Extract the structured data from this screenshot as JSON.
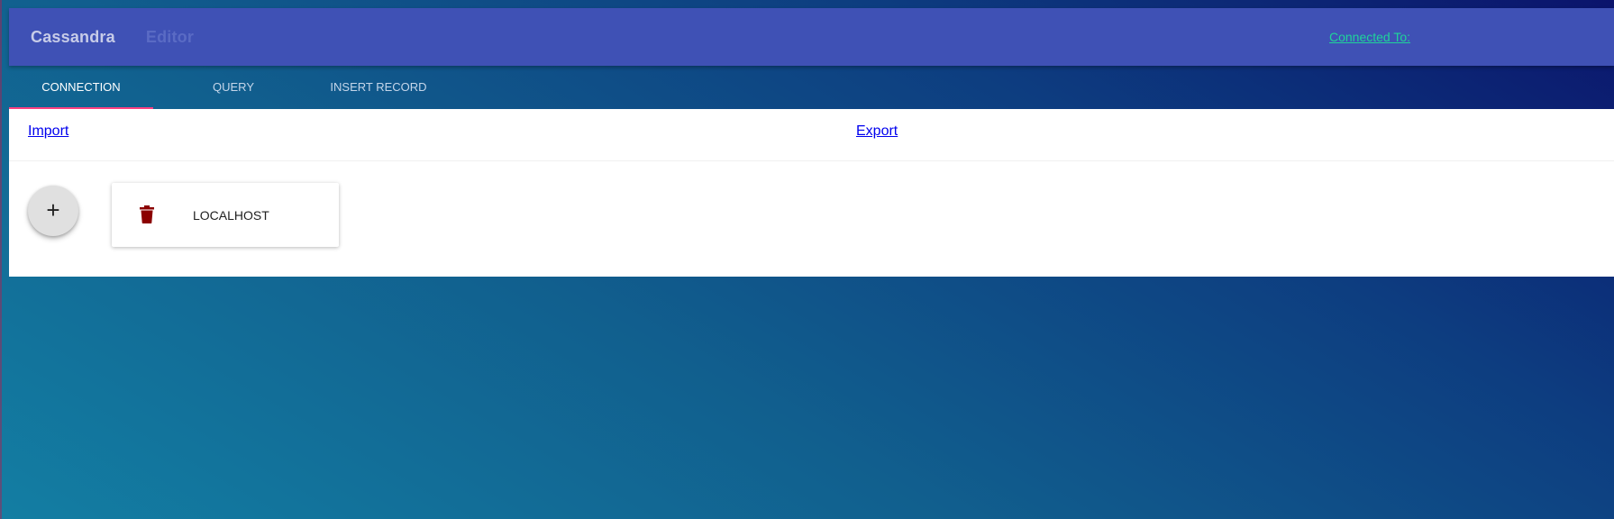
{
  "header": {
    "title_word1": "Cassandra",
    "title_word2": "Editor",
    "connected_label": "Connected To:",
    "background_color": "#3f51b5"
  },
  "tabs": [
    {
      "label": "CONNECTION",
      "active": true
    },
    {
      "label": "QUERY",
      "active": false
    },
    {
      "label": "INSERT RECORD",
      "active": false
    }
  ],
  "panel": {
    "import_label": "Import",
    "export_label": "Export",
    "add_button_glyph": "+",
    "connections": [
      {
        "name": "LOCALHOST",
        "icon": "trash-icon",
        "icon_color": "#8b0000"
      }
    ]
  },
  "accent_color": "#ff4081"
}
